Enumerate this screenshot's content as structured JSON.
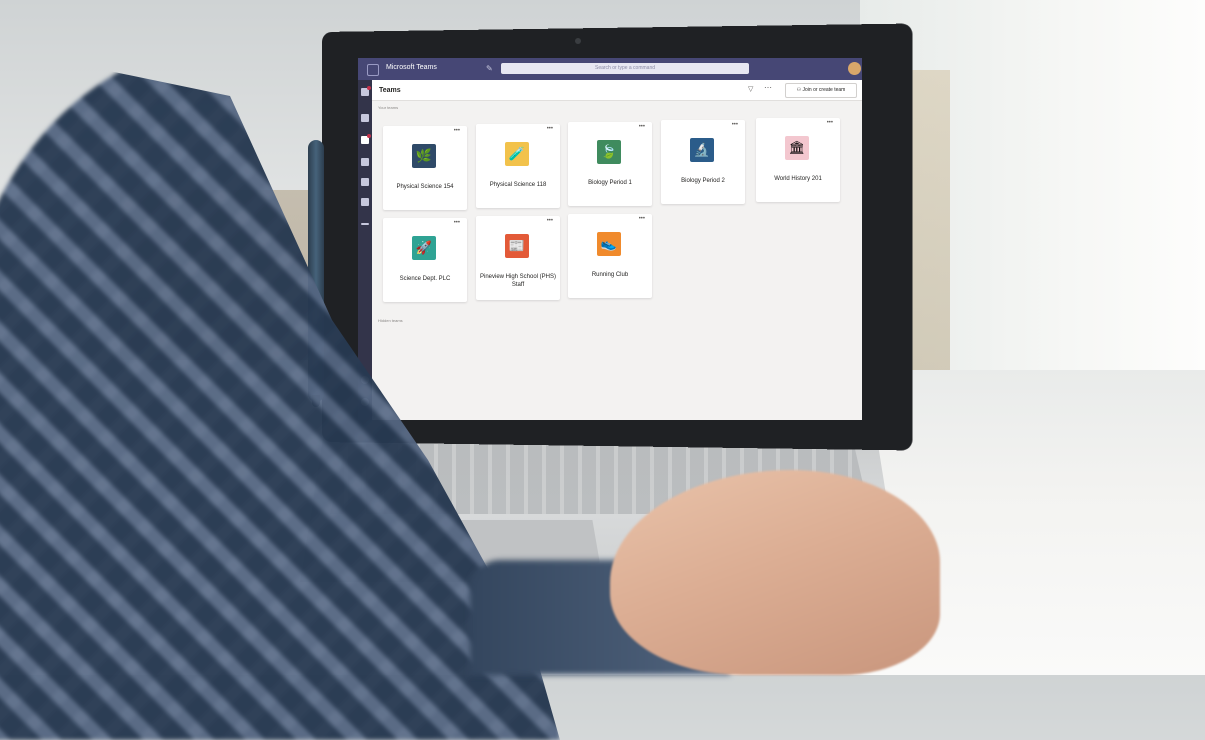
{
  "app": {
    "title": "Microsoft Teams",
    "search_placeholder": "Search or type a command",
    "accent": "#464775"
  },
  "header": {
    "title": "Teams",
    "join_button": "Join or create team"
  },
  "sections": {
    "your_teams": "Your teams",
    "hidden_teams": "Hidden teams"
  },
  "teams": [
    {
      "name": "Physical Science 154",
      "icon": "sprout-icon",
      "glyph": "🌿",
      "color": "#2f4a68"
    },
    {
      "name": "Physical Science 118",
      "icon": "lab-flask-icon",
      "glyph": "🧪",
      "color": "#f2c24b"
    },
    {
      "name": "Biology Period 1",
      "icon": "leaf-icon",
      "glyph": "🍃",
      "color": "#3f8b5e"
    },
    {
      "name": "Biology Period 2",
      "icon": "cell-icon",
      "glyph": "🔬",
      "color": "#2b5c8a"
    },
    {
      "name": "World History 201",
      "icon": "temple-icon",
      "glyph": "🏛",
      "color": "#f3c7cf"
    },
    {
      "name": "Science Dept. PLC",
      "icon": "rocket-icon",
      "glyph": "🚀",
      "color": "#2fa394"
    },
    {
      "name": "Pineview High School (PHS) Staff",
      "icon": "newsletter-icon",
      "glyph": "📰",
      "color": "#e35a38"
    },
    {
      "name": "Running Club",
      "icon": "shoe-icon",
      "glyph": "👟",
      "color": "#f08a2c"
    }
  ]
}
